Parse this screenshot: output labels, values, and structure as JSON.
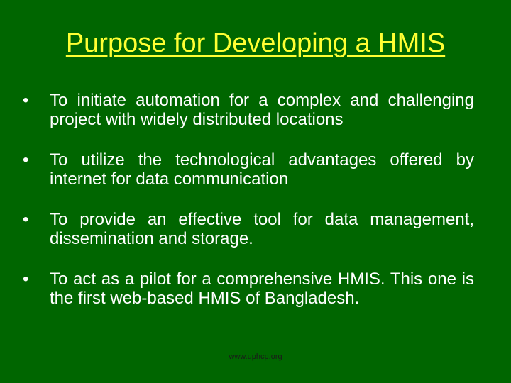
{
  "slide": {
    "title": "Purpose for Developing a HMIS",
    "bullets": [
      {
        "text": "To initiate automation for a complex and challenging project with widely distributed locations"
      },
      {
        "text": "To utilize the technological advantages offered by internet for data communication"
      },
      {
        "text": "To provide an effective tool for data management, dissemination and storage."
      },
      {
        "text": "To act as a pilot for a comprehensive HMIS. This one is the first web-based HMIS of Bangladesh."
      }
    ],
    "footer": "www.uphcp.org",
    "bullet_glyph": "•",
    "colors": {
      "background": "#006600",
      "title": "#ffff33",
      "text": "#ffffff",
      "footer": "#1a1a1a"
    }
  }
}
